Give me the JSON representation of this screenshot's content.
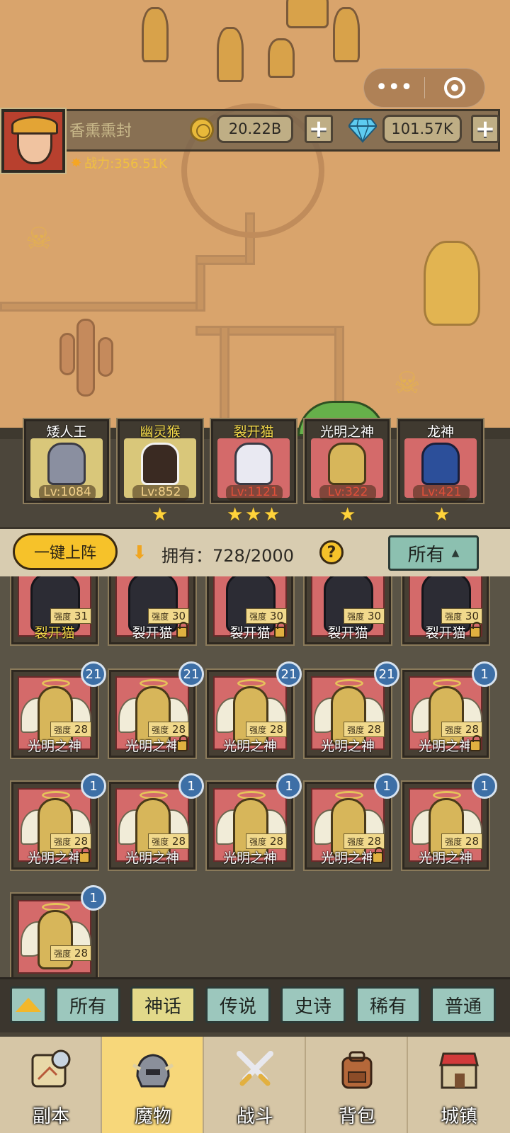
{
  "header": {
    "player_name": "香熏熏封",
    "power": "战力:356.51K",
    "gold": "20.22B",
    "gems": "101.57K"
  },
  "team": [
    {
      "name": "矮人王",
      "level": "Lv:1084",
      "stars": 1
    },
    {
      "name": "幽灵猴",
      "level": "Lv:852",
      "stars": 0
    },
    {
      "name": "裂开猫",
      "level": "Lv:1121",
      "stars": 3
    },
    {
      "name": "光明之神",
      "level": "Lv:322",
      "stars": 1
    },
    {
      "name": "龙神",
      "level": "Lv:421",
      "stars": 1
    }
  ],
  "controls": {
    "auto_deploy_label": "一键上阵",
    "owned_text": "拥有：728/2000",
    "help_label": "?",
    "filter_label": "所有"
  },
  "monsters": [
    {
      "name": "裂开猫",
      "strength": "31",
      "badge": "",
      "locked": false,
      "yellow": true
    },
    {
      "name": "裂开猫",
      "strength": "30",
      "badge": "",
      "locked": true,
      "yellow": false
    },
    {
      "name": "裂开猫",
      "strength": "30",
      "badge": "",
      "locked": true,
      "yellow": false
    },
    {
      "name": "裂开猫",
      "strength": "30",
      "badge": "",
      "locked": false,
      "yellow": false
    },
    {
      "name": "裂开猫",
      "strength": "30",
      "badge": "",
      "locked": true,
      "yellow": false
    },
    {
      "name": "光明之神",
      "strength": "28",
      "badge": "21",
      "locked": false,
      "yellow": false
    },
    {
      "name": "光明之神",
      "strength": "28",
      "badge": "21",
      "locked": true,
      "yellow": false
    },
    {
      "name": "光明之神",
      "strength": "28",
      "badge": "21",
      "locked": false,
      "yellow": false
    },
    {
      "name": "光明之神",
      "strength": "28",
      "badge": "21",
      "locked": false,
      "yellow": false
    },
    {
      "name": "光明之神",
      "strength": "28",
      "badge": "1",
      "locked": true,
      "yellow": false
    },
    {
      "name": "光明之神",
      "strength": "28",
      "badge": "1",
      "locked": true,
      "yellow": false
    },
    {
      "name": "光明之神",
      "strength": "28",
      "badge": "1",
      "locked": false,
      "yellow": false
    },
    {
      "name": "光明之神",
      "strength": "28",
      "badge": "1",
      "locked": false,
      "yellow": false
    },
    {
      "name": "光明之神",
      "strength": "28",
      "badge": "1",
      "locked": true,
      "yellow": false
    },
    {
      "name": "光明之神",
      "strength": "28",
      "badge": "1",
      "locked": false,
      "yellow": false
    },
    {
      "name": "",
      "strength": "28",
      "badge": "1",
      "locked": false,
      "yellow": false
    }
  ],
  "strength_label": "强度",
  "rarity_filters": [
    "所有",
    "神话",
    "传说",
    "史诗",
    "稀有",
    "普通"
  ],
  "rarity_active": "神话",
  "nav": [
    {
      "label": "副本",
      "icon": "map-icon"
    },
    {
      "label": "魔物",
      "icon": "monster-helmet-icon"
    },
    {
      "label": "战斗",
      "icon": "crossed-swords-icon"
    },
    {
      "label": "背包",
      "icon": "backpack-icon"
    },
    {
      "label": "城镇",
      "icon": "shop-icon"
    }
  ],
  "nav_active": "魔物"
}
